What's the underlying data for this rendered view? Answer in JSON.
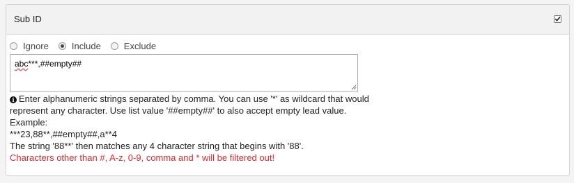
{
  "panel": {
    "title": "Sub ID",
    "enabled_checked": true
  },
  "radio_options": [
    {
      "label": "Ignore",
      "checked": false
    },
    {
      "label": "Include",
      "checked": true
    },
    {
      "label": "Exclude",
      "checked": false
    }
  ],
  "textarea": {
    "value_prefix_misspelled": "abc",
    "value_rest": "***,##empty##"
  },
  "help": {
    "line1": "Enter alphanumeric strings separated by comma. You can use '*' as wildcard that would",
    "line2": "represent any character. Use list value '##empty##' to also accept empty lead value.",
    "line3": "Example:",
    "line4": "***23,88**,##empty##,a**4",
    "line5": "The string '88**' then matches any 4 character string that begins with '88'.",
    "warning": "Characters other than #, A-z, 0-9, comma and * will be filtered out!"
  },
  "icons": {
    "info": "info-circle-icon",
    "checkbox": "checkmark-icon",
    "resize": "resize-grip-icon"
  },
  "colors": {
    "warning": "#e3262a",
    "spellcheck_underline": "#e02020"
  }
}
